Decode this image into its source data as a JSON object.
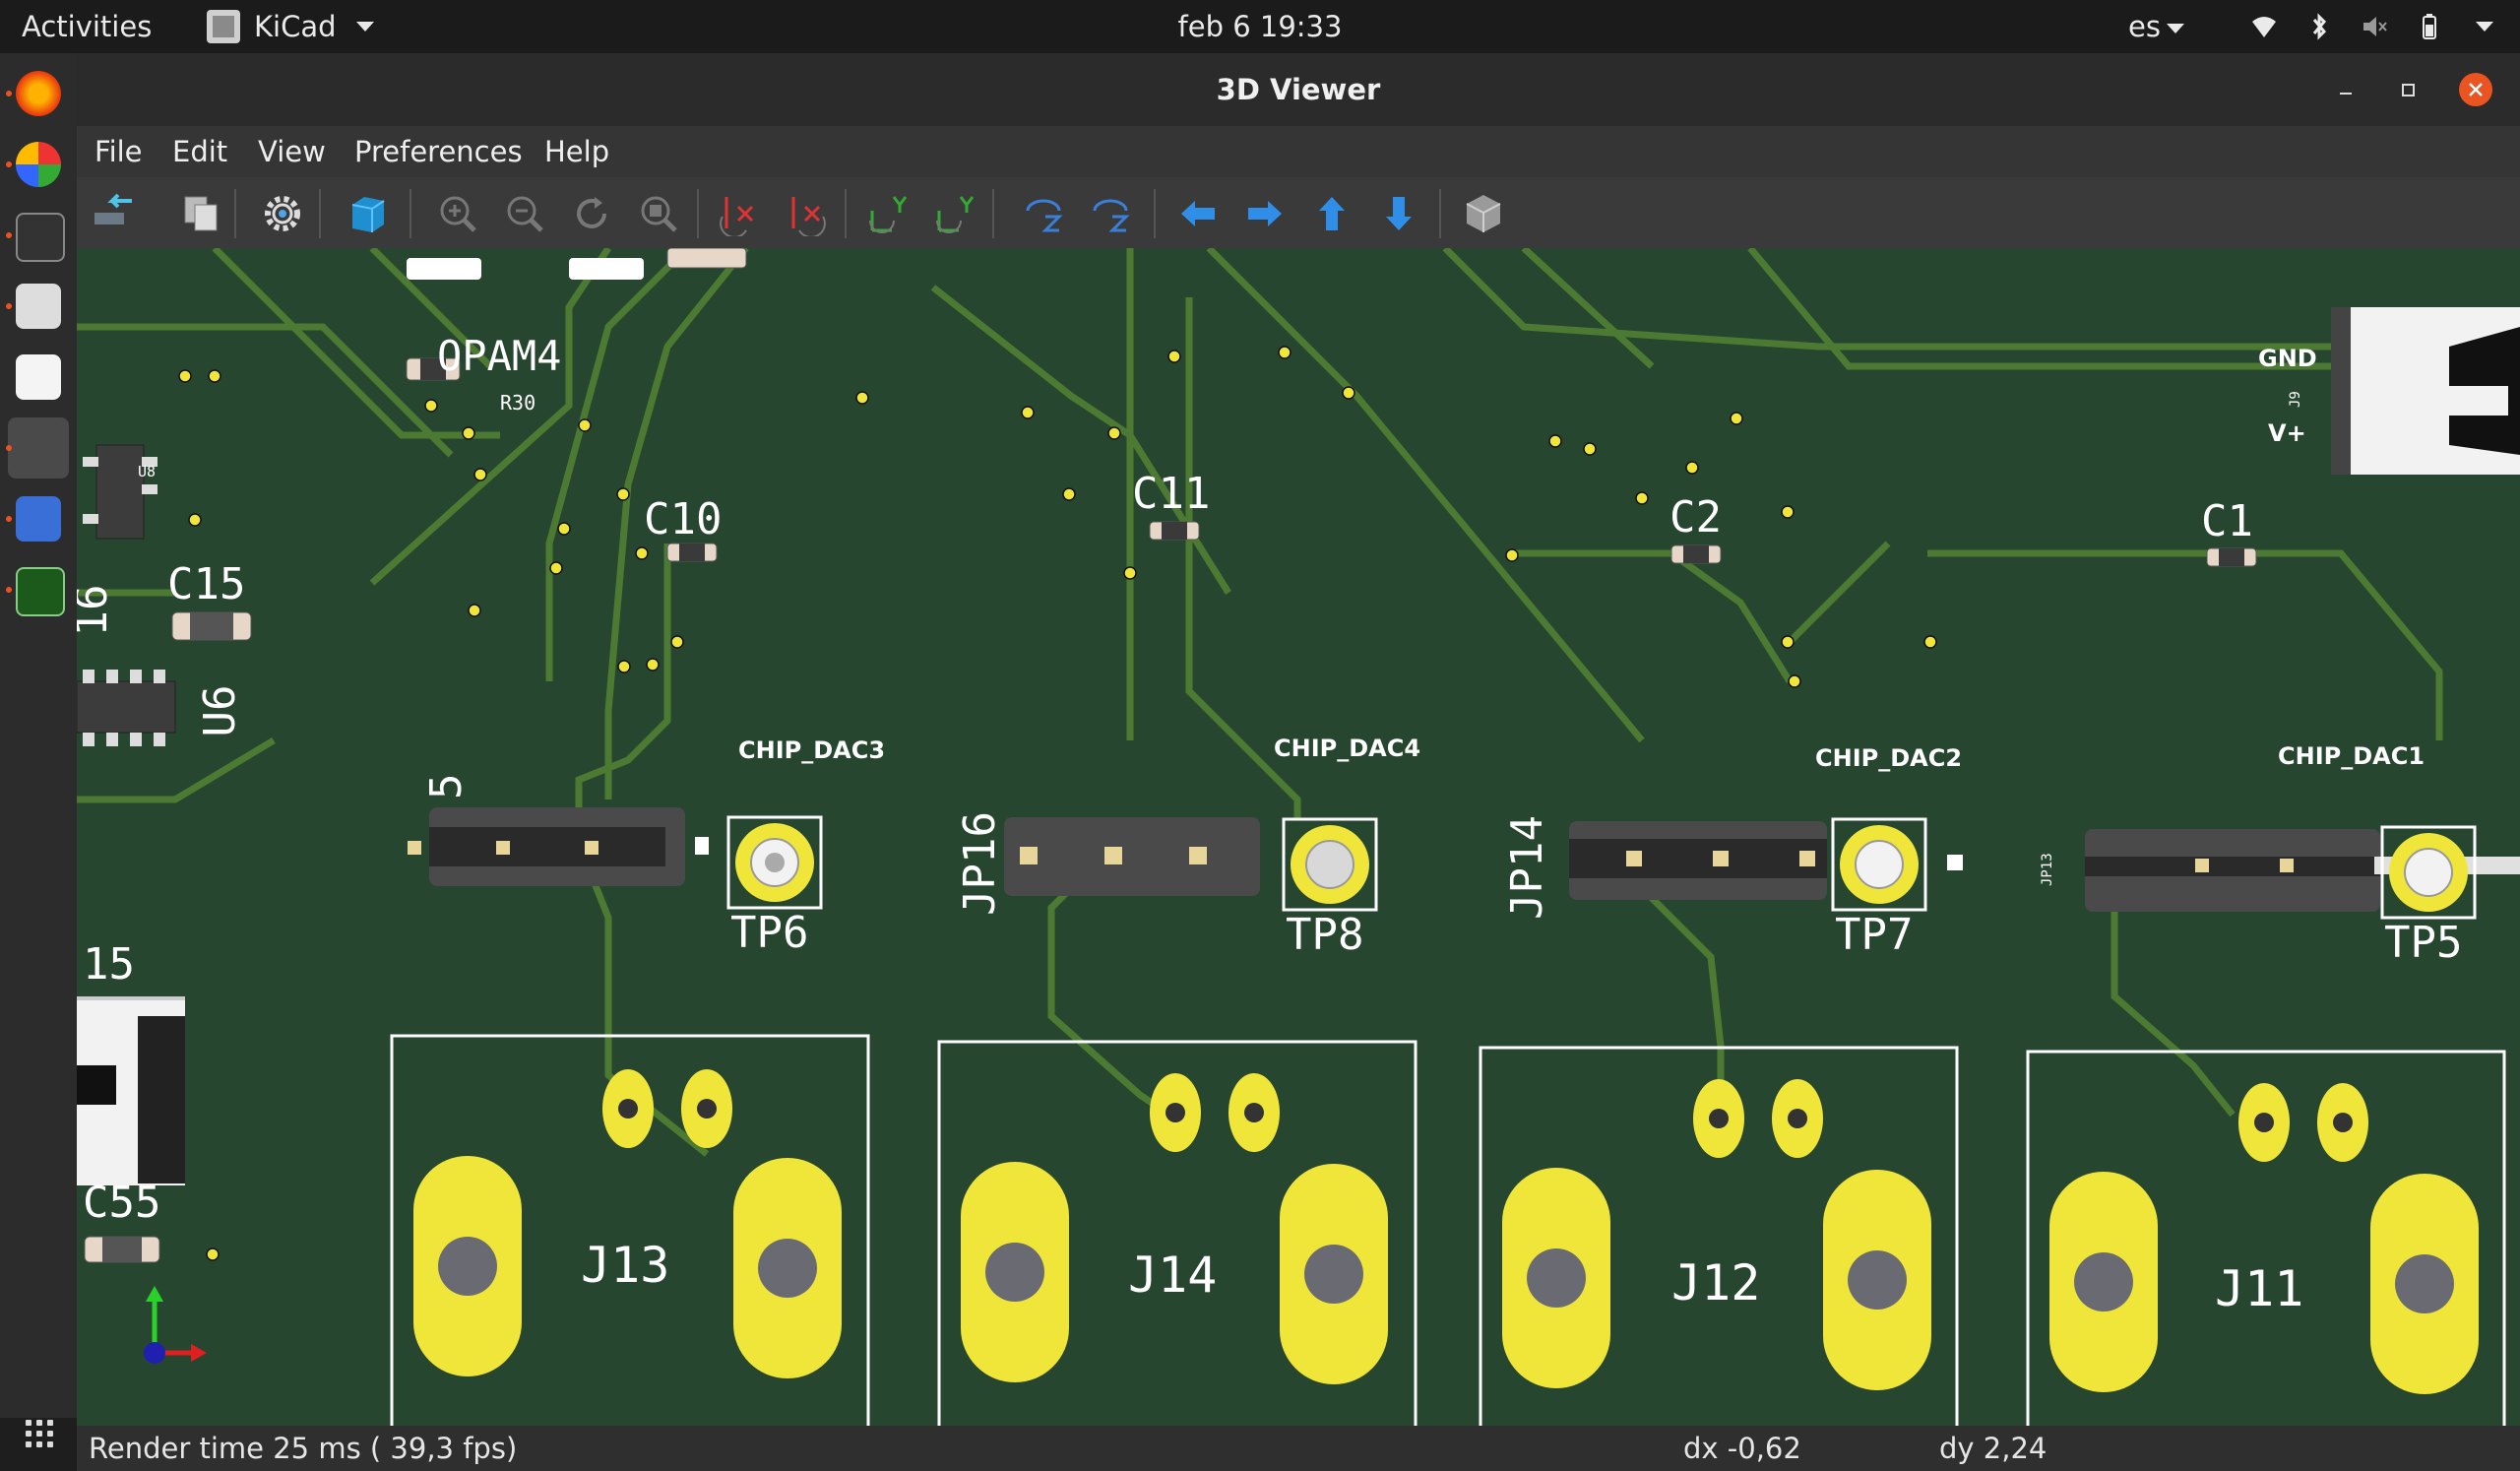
{
  "topbar": {
    "activities": "Activities",
    "app_name": "KiCad",
    "datetime": "feb 6  19:33",
    "language": "es"
  },
  "window": {
    "title": "3D Viewer",
    "menu": [
      "File",
      "Edit",
      "View",
      "Preferences",
      "Help"
    ]
  },
  "toolbar": {
    "tools": [
      "reload-board-icon",
      "copy-image-icon",
      "settings-gear-icon",
      "raytracing-cube-icon",
      "zoom-in-icon",
      "zoom-out-icon",
      "redraw-icon",
      "zoom-fit-icon",
      "rotate-x-cw-icon",
      "rotate-x-ccw-icon",
      "rotate-y-cw-icon",
      "rotate-y-ccw-icon",
      "rotate-z-cw-icon",
      "rotate-z-ccw-icon",
      "pan-left-icon",
      "pan-right-icon",
      "pan-up-icon",
      "pan-down-icon",
      "view-iso-icon"
    ]
  },
  "pcb": {
    "silk_labels": {
      "opamp": "OPAM4",
      "r30": "R30",
      "u8": "U8",
      "c15": "C15",
      "u6": "U6",
      "l16": "16",
      "c10": "C10",
      "c11": "C11",
      "c2": "C2",
      "c1": "C1",
      "gnd": "GND",
      "vplus": "V+",
      "j9": "J9",
      "chip_dac3": "CHIP_DAC3",
      "chip_dac4": "CHIP_DAC4",
      "chip_dac2": "CHIP_DAC2",
      "chip_dac1": "CHIP_DAC1",
      "jp15": "5",
      "jp16": "JP16",
      "jp14": "JP14",
      "jp13": "JP13",
      "tp6": "TP6",
      "tp8": "TP8",
      "tp7": "TP7",
      "tp5": "TP5",
      "l15": "15",
      "c55": "C55",
      "j13": "J13",
      "j14": "J14",
      "j12": "J12",
      "j11": "J11"
    },
    "colors": {
      "board": "#274630",
      "trace": "#4c7a32",
      "pad": "#f0e63a",
      "silk": "#ffffff"
    }
  },
  "status": {
    "render": "Render time 25 ms ( 39,3 fps)",
    "dx": "dx -0,62",
    "dy": "dy 2,24"
  }
}
